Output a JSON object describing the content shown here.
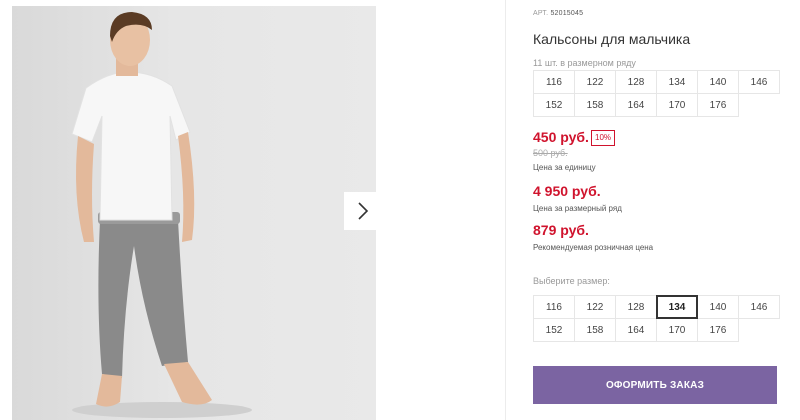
{
  "product": {
    "art_label": "АРТ.",
    "art_number": "52015045",
    "title": "Кальсоны для мальчика",
    "series_hint": "11 шт. в размерном ряду"
  },
  "series_sizes": [
    [
      "116",
      "122",
      "128",
      "134",
      "140",
      "146"
    ],
    [
      "152",
      "158",
      "164",
      "170",
      "176"
    ]
  ],
  "prices": {
    "unit_price": "450 руб.",
    "discount": "10%",
    "old_price": "500 руб.",
    "unit_caption": "Цена за единицу",
    "series_price": "4 950 руб.",
    "series_caption": "Цена за размерный ряд",
    "retail_price": "879 руб.",
    "retail_caption": "Рекомендуемая розничная цена"
  },
  "size_picker": {
    "label": "Выберите размер:",
    "rows": [
      [
        "116",
        "122",
        "128",
        "134",
        "140",
        "146"
      ],
      [
        "152",
        "158",
        "164",
        "170",
        "176"
      ]
    ],
    "selected": "134"
  },
  "order_button": "ОФОРМИТЬ ЗАКАЗ",
  "colors": {
    "price_red": "#d0132d",
    "button_purple": "#7b64a2"
  },
  "icons": {
    "gallery_next": "chevron-right-icon"
  }
}
